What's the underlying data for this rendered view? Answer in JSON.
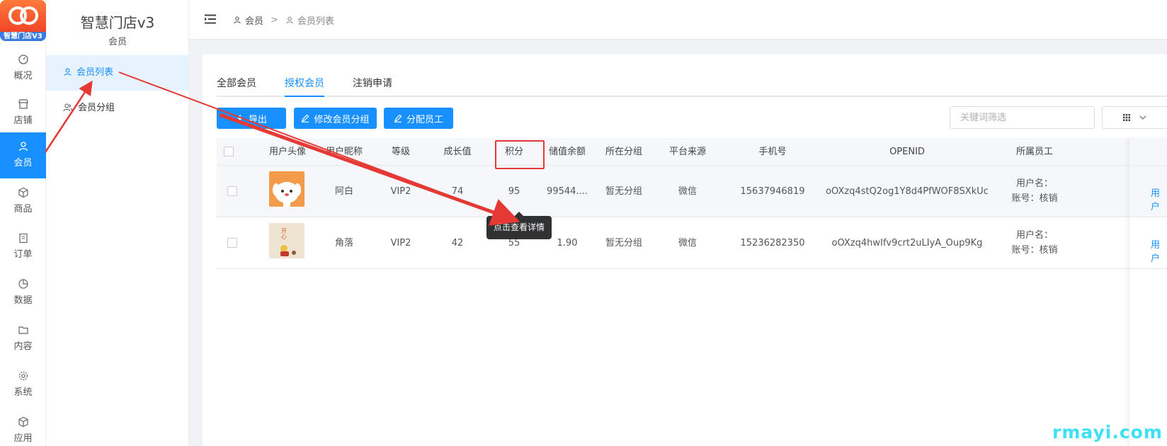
{
  "logo": {
    "text": "智慧门店V3"
  },
  "rail": {
    "items": [
      {
        "label": "概况",
        "icon": "dashboard-icon"
      },
      {
        "label": "店铺",
        "icon": "store-icon"
      },
      {
        "label": "会员",
        "icon": "user-icon",
        "active": true
      },
      {
        "label": "商品",
        "icon": "box-icon"
      },
      {
        "label": "订单",
        "icon": "clipboard-icon"
      },
      {
        "label": "数据",
        "icon": "pie-chart-icon"
      },
      {
        "label": "内容",
        "icon": "folder-icon"
      },
      {
        "label": "系统",
        "icon": "gear-icon"
      },
      {
        "label": "应用",
        "icon": "cube-icon"
      }
    ]
  },
  "submenu": {
    "title": "智慧门店v3",
    "group": "会员",
    "items": [
      {
        "label": "会员列表",
        "active": true
      },
      {
        "label": "会员分组"
      }
    ]
  },
  "header": {
    "breadcrumb": [
      "会员",
      "会员列表"
    ],
    "separator": ">"
  },
  "tabs": [
    {
      "label": "全部会员"
    },
    {
      "label": "授权会员",
      "active": true
    },
    {
      "label": "注销申请"
    }
  ],
  "toolbar": {
    "export_label": "导出",
    "edit_group_label": "修改会员分组",
    "assign_staff_label": "分配员工",
    "search_placeholder": "关键词筛选"
  },
  "table": {
    "columns": [
      "用户头像",
      "用户昵称",
      "等级",
      "成长值",
      "积分",
      "储值余额",
      "所在分组",
      "平台来源",
      "手机号",
      "OPENID",
      "所属员工"
    ],
    "rows": [
      {
        "nickname": "阿白",
        "level": "VIP2",
        "growth": "74",
        "points": "95",
        "balance": "99544....",
        "group": "暂无分组",
        "source": "微信",
        "phone": "15637946819",
        "openid": "oOXzq4stQ2og1Y8d4PfWOF8SXkUc",
        "staff_user": "用户名：",
        "staff_account": "账号：核销",
        "op": "用户"
      },
      {
        "nickname": "角落",
        "level": "VIP2",
        "growth": "42",
        "points": "55",
        "balance": "1.90",
        "group": "暂无分组",
        "source": "微信",
        "phone": "15236282350",
        "openid": "oOXzq4hwIfv9crt2uLIyA_Oup9Kg",
        "staff_user": "用户名：",
        "staff_account": "账号：核销",
        "op": "用户"
      }
    ]
  },
  "tooltip": "点击查看详情",
  "watermark": "rmayi.com",
  "colors": {
    "primary": "#1890ff",
    "annotation": "#e53935",
    "watermark": "#3ee0f5"
  }
}
